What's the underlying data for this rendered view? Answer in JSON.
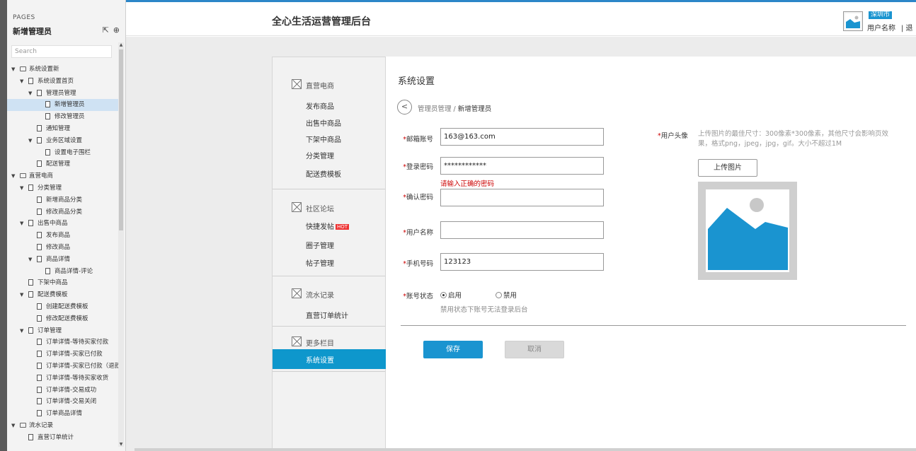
{
  "pages_panel": {
    "header": "PAGES",
    "current_page": "新增管理员",
    "search_placeholder": "Search",
    "tree": [
      {
        "label": "系统设置新",
        "type": "folder",
        "level": 0,
        "expanded": true
      },
      {
        "label": "系统设置首页",
        "type": "page",
        "level": 1,
        "expanded": true
      },
      {
        "label": "管理员管理",
        "type": "page",
        "level": 2,
        "expanded": true
      },
      {
        "label": "新增管理员",
        "type": "page",
        "level": 3,
        "selected": true
      },
      {
        "label": "修改管理员",
        "type": "page",
        "level": 3
      },
      {
        "label": "通知管理",
        "type": "page",
        "level": 2
      },
      {
        "label": "业务区域设置",
        "type": "page",
        "level": 2,
        "expanded": true
      },
      {
        "label": "设置电子围栏",
        "type": "page",
        "level": 3
      },
      {
        "label": "配送管理",
        "type": "page",
        "level": 2
      },
      {
        "label": "直营电商",
        "type": "folder",
        "level": 0,
        "expanded": true
      },
      {
        "label": "分类管理",
        "type": "page",
        "level": 1,
        "expanded": true
      },
      {
        "label": "新增商品分类",
        "type": "page",
        "level": 2
      },
      {
        "label": "修改商品分类",
        "type": "page",
        "level": 2
      },
      {
        "label": "出售中商品",
        "type": "page",
        "level": 1,
        "expanded": true
      },
      {
        "label": "发布商品",
        "type": "page",
        "level": 2
      },
      {
        "label": "修改商品",
        "type": "page",
        "level": 2
      },
      {
        "label": "商品详情",
        "type": "page",
        "level": 2,
        "expanded": true
      },
      {
        "label": "商品详情-评论",
        "type": "page",
        "level": 3
      },
      {
        "label": "下架中商品",
        "type": "page",
        "level": 1
      },
      {
        "label": "配送费模板",
        "type": "page",
        "level": 1,
        "expanded": true
      },
      {
        "label": "创建配送费模板",
        "type": "page",
        "level": 2
      },
      {
        "label": "修改配送费模板",
        "type": "page",
        "level": 2
      },
      {
        "label": "订单管理",
        "type": "page",
        "level": 1,
        "expanded": true
      },
      {
        "label": "订单详情-等待买家付款",
        "type": "page",
        "level": 2
      },
      {
        "label": "订单详情-买家已付款",
        "type": "page",
        "level": 2
      },
      {
        "label": "订单详情-买家已付款（退款",
        "type": "page",
        "level": 2
      },
      {
        "label": "订单详情-等待买家收货",
        "type": "page",
        "level": 2
      },
      {
        "label": "订单详情-交易成功",
        "type": "page",
        "level": 2
      },
      {
        "label": "订单详情-交易关闭",
        "type": "page",
        "level": 2
      },
      {
        "label": "订单商品详情",
        "type": "page",
        "level": 2
      },
      {
        "label": "流水记录",
        "type": "folder",
        "level": 0,
        "expanded": true
      },
      {
        "label": "直营订单统计",
        "type": "page",
        "level": 1
      }
    ]
  },
  "header": {
    "app_title": "全心生活运营管理后台",
    "city": "深圳市",
    "user_name": "用户名称",
    "logout": "| 退"
  },
  "menu": {
    "sections": [
      {
        "title": "直营电商",
        "items": [
          "发布商品",
          "出售中商品",
          "下架中商品",
          "分类管理",
          "配送费模板"
        ]
      },
      {
        "title": "社区论坛",
        "items": [
          "快捷发帖",
          "圈子管理",
          "帖子管理"
        ],
        "hot_tag": "HOT"
      },
      {
        "title": "流水记录",
        "items": [
          "直营订单统计"
        ]
      },
      {
        "title": "更多栏目",
        "items": []
      }
    ],
    "active_item": "系统设置"
  },
  "content": {
    "section_title": "系统设置",
    "breadcrumb": {
      "back": "<",
      "parent": "管理员管理",
      "separator": " / ",
      "current": "新增管理员"
    },
    "form": {
      "email_label": "邮箱账号",
      "email_value": "163@163.com",
      "password_label": "登录密码",
      "password_value": "************",
      "password_error": "请输入正确的密码",
      "confirm_label": "确认密码",
      "confirm_value": "",
      "username_label": "用户名称",
      "username_value": "",
      "phone_label": "手机号码",
      "phone_value": "123123",
      "status_label": "账号状态",
      "status_enabled": "启用",
      "status_disabled": "禁用",
      "status_hint": "禁用状态下账号无法登录后台",
      "required_mark": "*"
    },
    "avatar": {
      "label": "用户头像",
      "hint": "上传图片的最佳尺寸：300像素*300像素，其他尺寸会影响页效果，格式png，jpeg，jpg，gif。大小不超过1M",
      "upload_button": "上传图片"
    },
    "buttons": {
      "save": "保存",
      "cancel": "取消"
    }
  },
  "colors": {
    "accent": "#1a94d0",
    "active_menu": "#0e97cc",
    "error": "#cc0000",
    "canvas": "#ececec"
  }
}
